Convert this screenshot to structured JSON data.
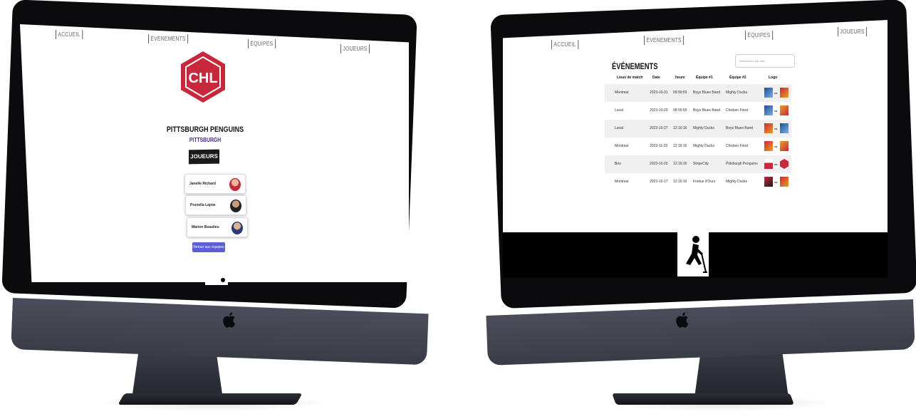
{
  "left_screen": {
    "nav": {
      "accueil": "ACCUEIL",
      "evenements": "ÉVENEMENTS",
      "equipes": "ÉQUIPES",
      "joueurs": "JOUEURS"
    },
    "team": {
      "logo_text": "CHL",
      "name": "PITTSBURGH PENGUINS",
      "city": "PITTSBURGH"
    },
    "players_heading": "JOUEURS",
    "players": [
      {
        "name": "Janelle Richard"
      },
      {
        "name": "Prunella Lajoie"
      },
      {
        "name": "Marion Beaulieu"
      }
    ],
    "back_button": "Retour aux équipes"
  },
  "right_screen": {
    "nav": {
      "accueil": "ACCUEIL",
      "evenements": "ÉVENEMENTS",
      "equipes": "ÉQUIPES",
      "joueurs": "JOUEURS"
    },
    "title": "ÉVÉNEMENTS",
    "search_placeholder": "Rechercher par ville",
    "columns": [
      "Lieux de match",
      "Date",
      "heure",
      "Équipe #1",
      "Équipe #2",
      "Logo"
    ],
    "rows": [
      {
        "lieu": "Montreal",
        "date": "2023-10-31",
        "heure": "09:59:59",
        "team1": "Boys Blues Band",
        "team2": "Mighty Ducks",
        "vs": "vs"
      },
      {
        "lieu": "Laval",
        "date": "2023-10-29",
        "heure": "08:55:55",
        "team1": "Boys Blues Band",
        "team2": "Chicken Fried",
        "vs": "vs"
      },
      {
        "lieu": "Laval",
        "date": "2023-10-27",
        "heure": "12:16:16",
        "team1": "Mighty Ducks",
        "team2": "Boys Blues Band",
        "vs": "vs"
      },
      {
        "lieu": "Montreal",
        "date": "2023-11-29",
        "heure": "12:16:16",
        "team1": "Mighty Ducks",
        "team2": "Chicken Fried",
        "vs": "vs"
      },
      {
        "lieu": "Brio",
        "date": "2023-10-20",
        "heure": "12:16:16",
        "team1": "StripeCity",
        "team2": "Pittsburgh Penguins",
        "vs": "vs"
      },
      {
        "lieu": "Montreal",
        "date": "2023-10-17",
        "heure": "12:16:16",
        "team1": "Foetus d'Ours",
        "team2": "Mighty Ducks",
        "vs": "vs"
      }
    ]
  },
  "colors": {
    "chl_red": "#c8283c",
    "button_blue": "#5a5fd6",
    "city_purple": "#4a2b8c",
    "imac_chin": "#42444f"
  }
}
